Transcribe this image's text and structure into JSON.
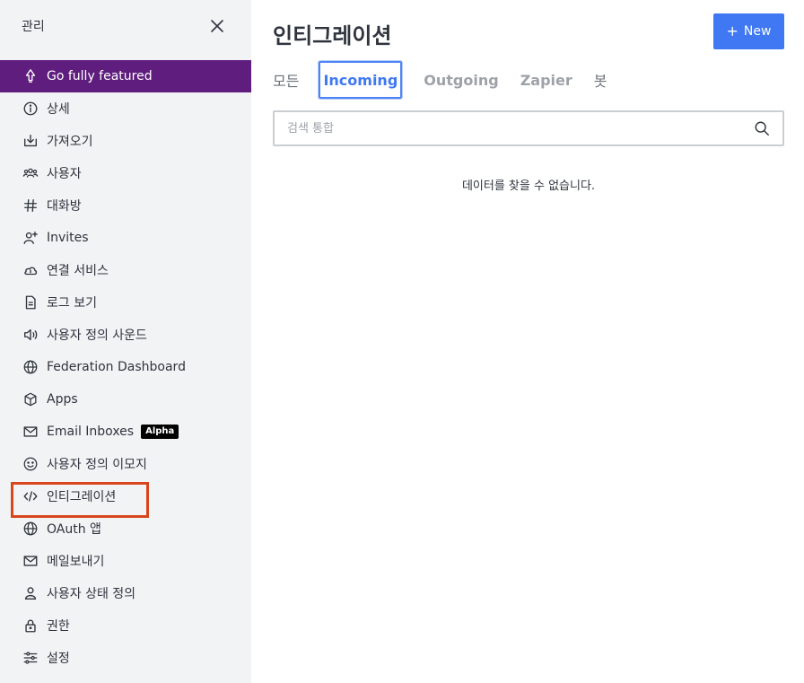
{
  "sidebar": {
    "title": "관리",
    "items": [
      {
        "label": "Go fully featured",
        "icon": "rocket-icon"
      },
      {
        "label": "상세",
        "icon": "info-icon"
      },
      {
        "label": "가져오기",
        "icon": "import-icon"
      },
      {
        "label": "사용자",
        "icon": "team-icon"
      },
      {
        "label": "대화방",
        "icon": "hashtag-icon"
      },
      {
        "label": "Invites",
        "icon": "user-plus-icon"
      },
      {
        "label": "연결 서비스",
        "icon": "cloud-connect-icon"
      },
      {
        "label": "로그 보기",
        "icon": "document-icon"
      },
      {
        "label": "사용자 정의 사운드",
        "icon": "volume-icon"
      },
      {
        "label": "Federation Dashboard",
        "icon": "globe-icon"
      },
      {
        "label": "Apps",
        "icon": "cube-icon"
      },
      {
        "label": "Email Inboxes",
        "icon": "mail-icon",
        "badge": "Alpha"
      },
      {
        "label": "사용자 정의 이모지",
        "icon": "emoji-icon"
      },
      {
        "label": "인티그레이션",
        "icon": "code-icon"
      },
      {
        "label": "OAuth 앱",
        "icon": "globe-icon"
      },
      {
        "label": "메일보내기",
        "icon": "mail-icon"
      },
      {
        "label": "사용자 상태 정의",
        "icon": "user-icon"
      },
      {
        "label": "권한",
        "icon": "lock-icon"
      },
      {
        "label": "설정",
        "icon": "customize-icon"
      }
    ]
  },
  "main": {
    "title": "인티그레이션",
    "new_button": "New",
    "tabs": [
      "모든",
      "Incoming",
      "Outgoing",
      "Zapier",
      "봇"
    ],
    "active_tab": "Incoming",
    "search": {
      "placeholder": "검색 통합",
      "value": ""
    },
    "empty_message": "데이터를 찾을 수 없습니다."
  },
  "colors": {
    "featured": "#5f1d7e",
    "primary": "#3f78f2",
    "highlight_box": "#d9451d",
    "sidebar_bg": "#f2f3f5"
  }
}
